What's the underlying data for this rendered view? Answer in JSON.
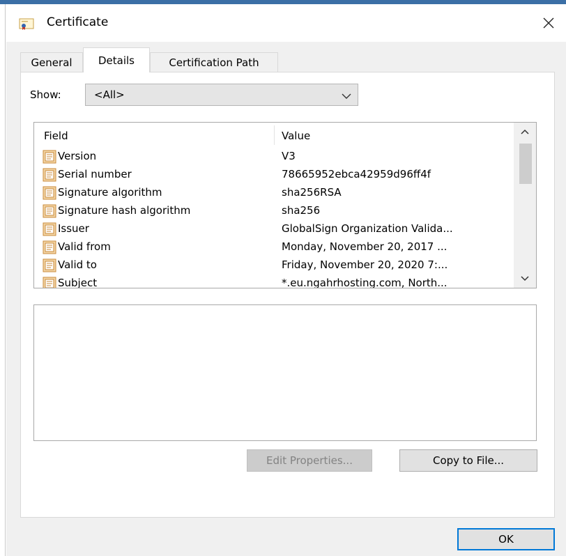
{
  "dialog": {
    "title": "Certificate",
    "close_glyph": "✕"
  },
  "tabs": [
    {
      "label": "General",
      "active": false
    },
    {
      "label": "Details",
      "active": true
    },
    {
      "label": "Certification Path",
      "active": false
    }
  ],
  "show": {
    "label": "Show:",
    "selected": "<All>"
  },
  "list": {
    "columns": {
      "field": "Field",
      "value": "Value"
    },
    "rows": [
      {
        "field": "Version",
        "value": "V3"
      },
      {
        "field": "Serial number",
        "value": "78665952ebca42959d96ff4f"
      },
      {
        "field": "Signature algorithm",
        "value": "sha256RSA"
      },
      {
        "field": "Signature hash algorithm",
        "value": "sha256"
      },
      {
        "field": "Issuer",
        "value": "GlobalSign Organization Valida..."
      },
      {
        "field": "Valid from",
        "value": "Monday, November 20, 2017 ..."
      },
      {
        "field": "Valid to",
        "value": "Friday, November 20, 2020 7:..."
      },
      {
        "field": "Subject",
        "value": "*.eu.ngahrhosting.com, North..."
      }
    ]
  },
  "buttons": {
    "edit_properties": "Edit Properties...",
    "copy_to_file": "Copy to File...",
    "ok": "OK"
  },
  "colors": {
    "accent": "#0078d7",
    "dialog_bg": "#f0f0f0"
  }
}
